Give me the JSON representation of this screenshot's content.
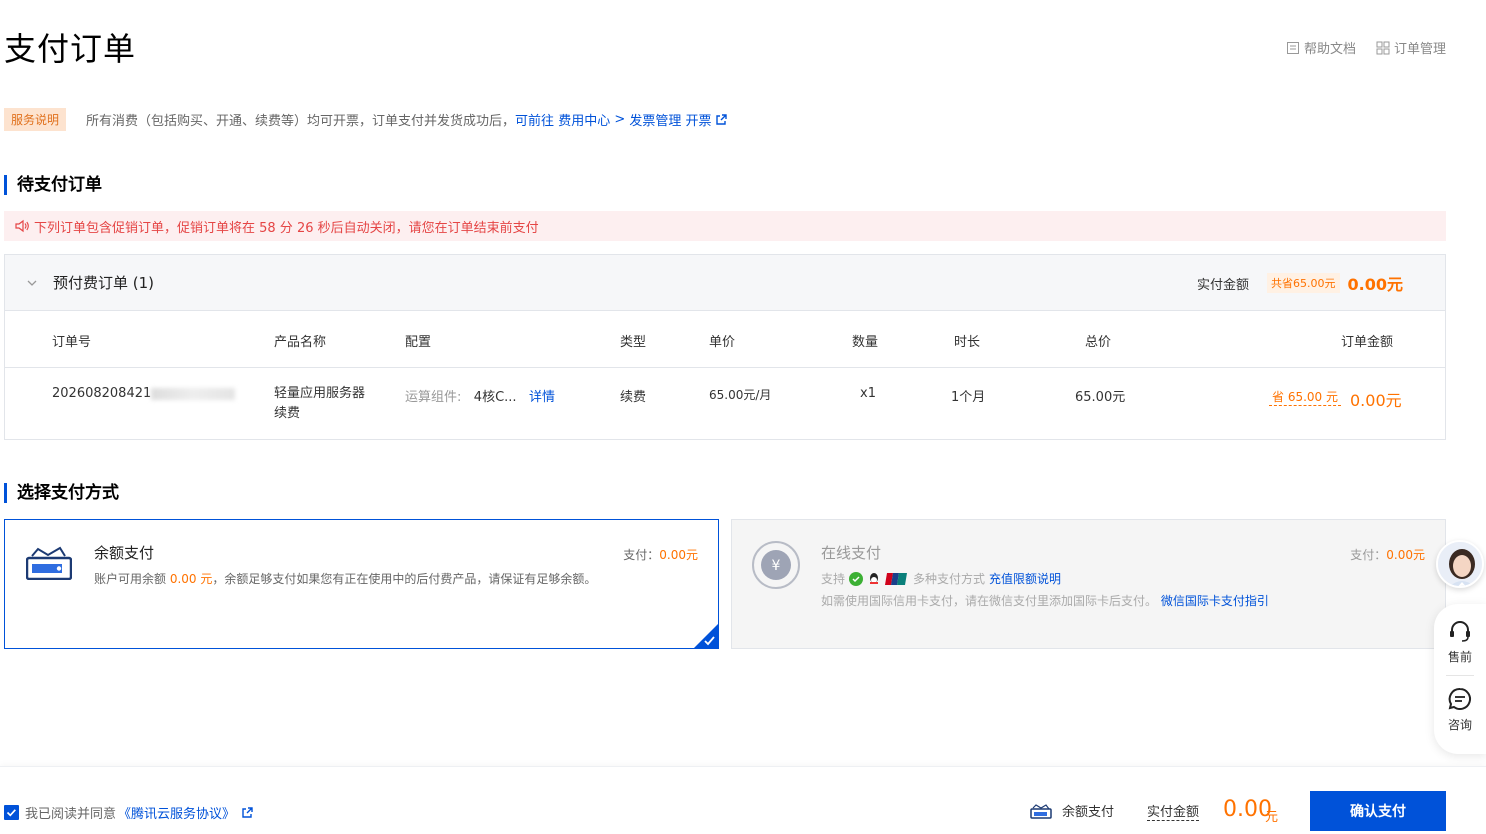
{
  "page": {
    "title": "支付订单"
  },
  "top_links": [
    {
      "label": "帮助文档",
      "icon": "document-icon"
    },
    {
      "label": "订单管理",
      "icon": "grid-icon"
    }
  ],
  "notice": {
    "badge": "服务说明",
    "text": "所有消费（包括购买、开通、续费等）均可开票，订单支付并发货成功后，",
    "link_prefix": "可前往",
    "link_center": "费用中心",
    "sep": ">",
    "link_invoice": "发票管理",
    "link_open": "开票"
  },
  "pending": {
    "section_title": "待支付订单",
    "warning": "下列订单包含促销订单，促销订单将在 58 分 26 秒后自动关闭，请您在订单结束前支付",
    "group_title": "预付费订单 (1)",
    "sum_label": "实付金额",
    "sum_saved": "共省65.00元",
    "sum_amount": "0.00元",
    "columns": [
      "订单号",
      "产品名称",
      "配置",
      "类型",
      "单价",
      "数量",
      "时长",
      "总价",
      "订单金额"
    ],
    "row": {
      "order_no": "202608208421",
      "product_line1": "轻量应用服务器",
      "product_line2": "续费",
      "config_label": "运算组件:",
      "config_value": "4核C...",
      "config_detail": "详情",
      "type": "续费",
      "unit_price": "65.00元/月",
      "quantity": "x1",
      "duration": "1个月",
      "total": "65.00元",
      "saved": "省 65.00 元",
      "amount": "0.00元"
    }
  },
  "payment": {
    "section_title": "选择支付方式",
    "balance": {
      "title": "余额支付",
      "pay_label": "支付：",
      "pay_amount": "0.00元",
      "desc_prefix": "账户可用余额",
      "desc_amount": "0.00 元",
      "desc_suffix": "，余额足够支付如果您有正在使用中的后付费产品，请保证有足够余额。"
    },
    "online": {
      "title": "在线支付",
      "pay_label": "支付：",
      "pay_amount": "0.00元",
      "support_label": "支持",
      "multi_label": "多种支付方式",
      "limit_link": "充值限额说明",
      "intl_text": "如需使用国际信用卡支付，请在微信支付里添加国际卡后支付。",
      "intl_link": "微信国际卡支付指引"
    }
  },
  "side": {
    "presale": "售前",
    "consult": "咨询"
  },
  "footer": {
    "agree_prefix": "我已阅读并同意",
    "agree_link": "《腾讯云服务协议》",
    "method": "余额支付",
    "amount_label": "实付金额",
    "amount_value": "0.00",
    "amount_unit": "元",
    "confirm": "确认支付"
  },
  "colors": {
    "accent": "#0052d9",
    "price": "#ff7200",
    "warn": "#e54545"
  }
}
